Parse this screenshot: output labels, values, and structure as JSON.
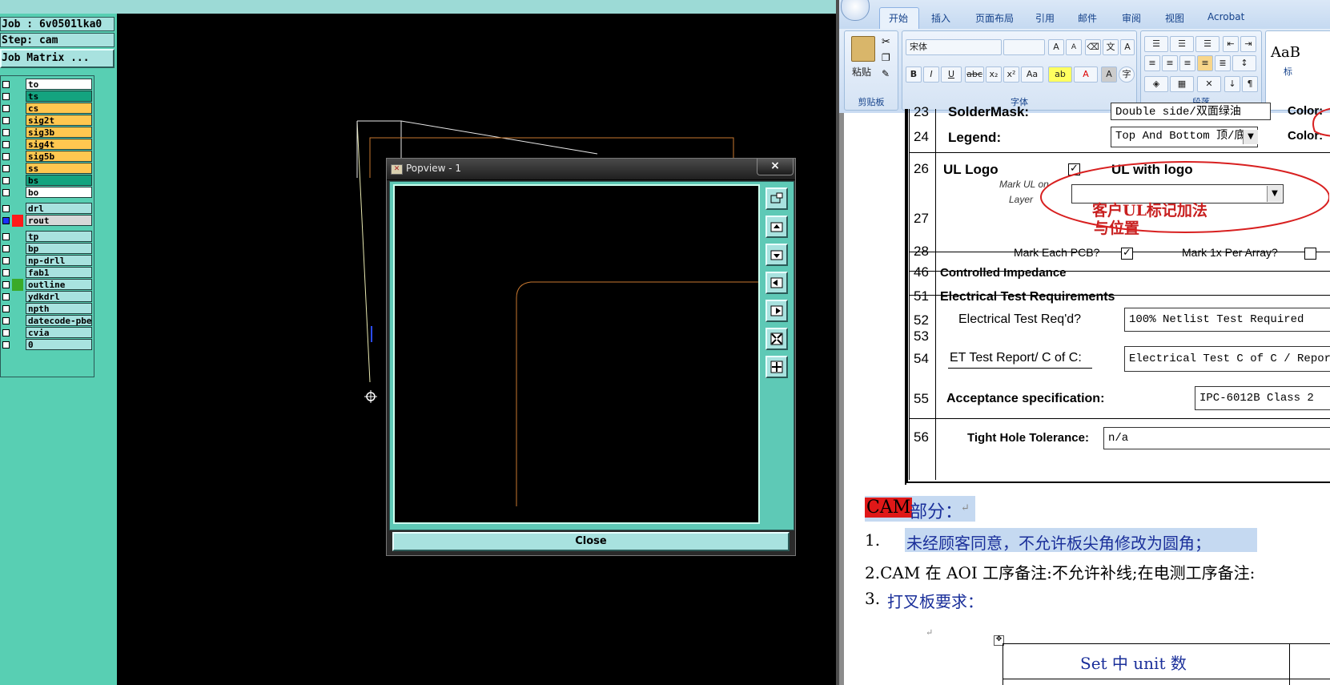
{
  "cam": {
    "job_label": "Job : 6v0501lka0",
    "step_label": "Step: cam",
    "job_matrix_button": "Job Matrix ...",
    "layers_group1": [
      {
        "name": "to",
        "color": "#ffffff"
      },
      {
        "name": "ts",
        "color": "#14a37f"
      },
      {
        "name": "cs",
        "color": "#ffc750"
      },
      {
        "name": "sig2t",
        "color": "#ffc750"
      },
      {
        "name": "sig3b",
        "color": "#ffc750"
      },
      {
        "name": "sig4t",
        "color": "#ffc750"
      },
      {
        "name": "sig5b",
        "color": "#ffc750"
      },
      {
        "name": "ss",
        "color": "#ffc750"
      },
      {
        "name": "bs",
        "color": "#14a37f"
      },
      {
        "name": "bo",
        "color": "#ffffff"
      }
    ],
    "layers_group2": [
      {
        "name": "drl",
        "color": "#a8e2df"
      },
      {
        "name": "rout",
        "color": "#d8d8d8"
      }
    ],
    "layers_group3": [
      {
        "name": "tp",
        "color": "#a8e2df"
      },
      {
        "name": "bp",
        "color": "#a8e2df"
      },
      {
        "name": "np-drll",
        "color": "#a8e2df"
      },
      {
        "name": "fab1",
        "color": "#a8e2df"
      },
      {
        "name": "outline",
        "color": "#a8e2df"
      },
      {
        "name": "ydkdrl",
        "color": "#a8e2df"
      },
      {
        "name": "npth",
        "color": "#a8e2df"
      },
      {
        "name": "datecode-pbe",
        "color": "#a8e2df"
      },
      {
        "name": "cvia",
        "color": "#a8e2df"
      },
      {
        "name": "0",
        "color": "#a8e2df"
      }
    ]
  },
  "popview": {
    "title": "Popview - 1",
    "close_x": "×",
    "close_button": "Close",
    "tools": [
      "zoom-window-icon",
      "zoom-in-icon",
      "zoom-out-icon",
      "pan-left-icon",
      "pan-right-icon",
      "fit-icon",
      "zoom-home-icon"
    ]
  },
  "word": {
    "tabs": [
      "开始",
      "插入",
      "页面布局",
      "引用",
      "邮件",
      "审阅",
      "视图",
      "Acrobat"
    ],
    "ribbon": {
      "paste_label": "粘贴",
      "clipboard_group": "剪贴板",
      "font_name": "宋体",
      "font_size": "",
      "font_group": "字体",
      "paragraph_group": "段落",
      "styles_preview": "AaB",
      "styles_label": "标"
    },
    "form": {
      "row23_num": "23",
      "row23_label": "SolderMask:",
      "row23_value": "Double side/双面绿油",
      "color_label": "Color:",
      "row24_num": "24",
      "row24_label": "Legend:",
      "row24_value": "Top And Bottom 顶/底",
      "row26_num": "26",
      "row26_label": "UL Logo",
      "row26_check": "✓",
      "ul_with_logo": "UL with logo",
      "row27_num": "27",
      "mark_ul_line1": "Mark UL on",
      "mark_ul_line2": "Layer",
      "annotation_line1": "客户UL标记加法",
      "annotation_line2": "与位置",
      "row28_num": "28",
      "mark_each_pcb": "Mark Each PCB?",
      "mark_each_check": "✓",
      "mark_1x": "Mark 1x Per Array?",
      "row46_num": "46",
      "row46_label": "Controlled Impedance",
      "row51_num": "51",
      "row51_label": "Electrical Test Requirements",
      "row52_num": "52",
      "row52_label": "Electrical Test Req'd?",
      "row52_value": "100% Netlist Test Required",
      "row53_num": "53",
      "row54_num": "54",
      "row54_label": "ET Test Report/ C of C:",
      "row54_value": "Electrical Test C of C / Report",
      "row55_num": "55",
      "row55_label": "Acceptance specification:",
      "row55_value": "IPC-6012B Class 2",
      "row56_num": "56",
      "row56_label": "Tight Hole Tolerance:",
      "row56_value": "n/a"
    },
    "body": {
      "heading_red": "CAM",
      "heading_rest": " 部分：",
      "item1_num": "1.",
      "item1_text": "未经顾客同意，不允许板尖角修改为圆角；",
      "item2_text": "2.CAM 在 AOI 工序备注:不允许补线;在电测工序备注:",
      "item3_num": "3.",
      "item3_text": "打叉板要求：",
      "table_header": "Set 中 unit 数",
      "para_mark": "↵"
    }
  }
}
